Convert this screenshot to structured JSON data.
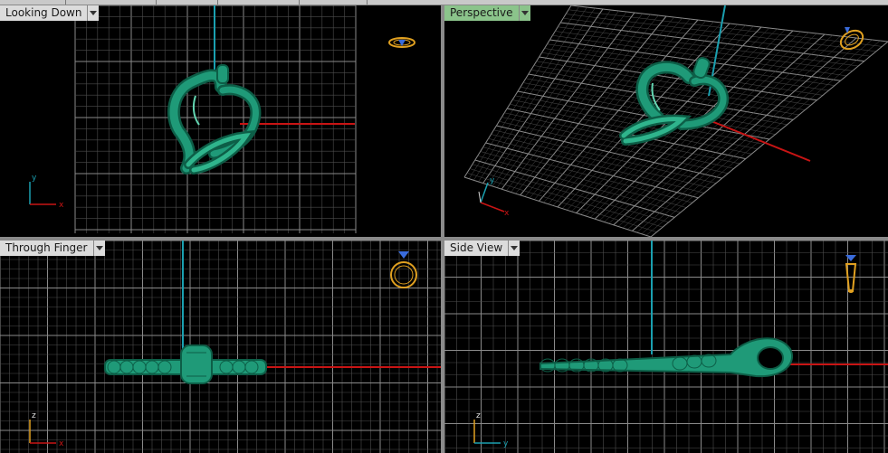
{
  "viewports": [
    {
      "id": "looking-down",
      "label": "Looking Down",
      "active": false,
      "axis_v": "y",
      "axis_h": "x"
    },
    {
      "id": "perspective",
      "label": "Perspective",
      "active": true,
      "axis_v": "y",
      "axis_h": "x"
    },
    {
      "id": "through-finger",
      "label": "Through Finger",
      "active": false,
      "axis_v": "z",
      "axis_h": "x"
    },
    {
      "id": "side-view",
      "label": "Side View",
      "active": false,
      "axis_v": "z",
      "axis_h": "y"
    }
  ],
  "colors": {
    "grid": "#8a8a8a",
    "grid_minor": "#4d4d4d",
    "axis_red": "#c81414",
    "axis_cyan": "#1aa0b0",
    "model": "#1f9a78",
    "model_dark": "#0d5e47",
    "model_light": "#63d6b2",
    "gizmo_gold": "#e0a020",
    "gizmo_blue": "#3a6cdc",
    "label_active": "#8bc48b",
    "label_bg": "#dcdcdc"
  },
  "icons": {
    "dropdown": "dropdown-arrow-icon",
    "ring_gizmo": "ring-orientation-icon"
  }
}
